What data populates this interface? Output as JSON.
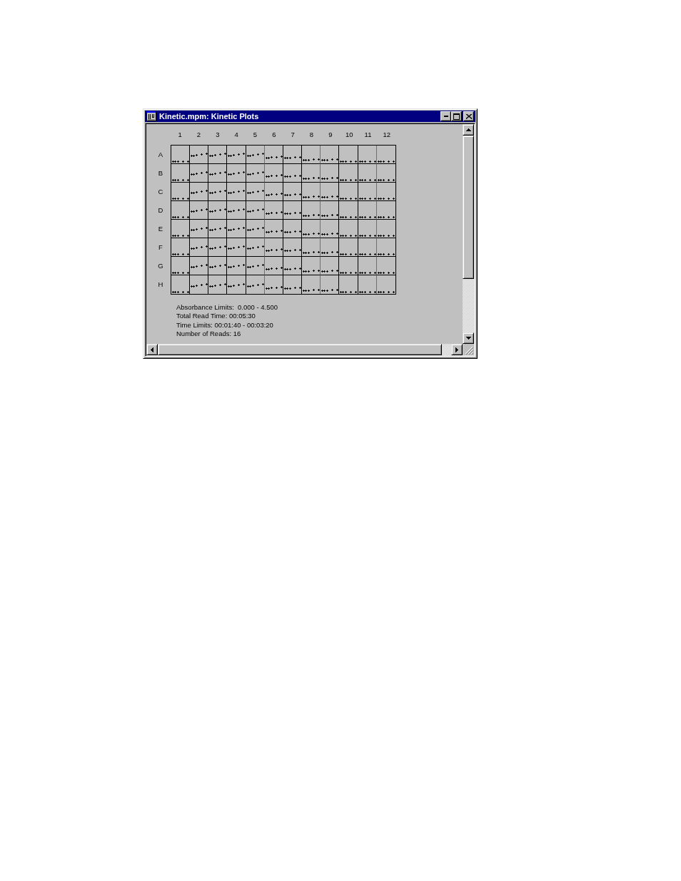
{
  "window": {
    "title": "Kinetic.mpm: Kinetic Plots"
  },
  "plate": {
    "columns": [
      "1",
      "2",
      "3",
      "4",
      "5",
      "6",
      "7",
      "8",
      "9",
      "10",
      "11",
      "12"
    ],
    "rows": [
      "A",
      "B",
      "C",
      "D",
      "E",
      "F",
      "G",
      "H"
    ]
  },
  "summary": [
    "Absorbance Limits:  0.000 - 4.500",
    "Total Read Time: 00:05:30",
    "Time Limits: 00:01:40 - 00:03:20",
    "Number of Reads: 16"
  ]
}
